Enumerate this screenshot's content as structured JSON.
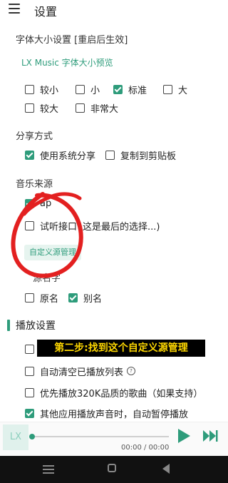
{
  "header": {
    "title": "设置"
  },
  "font_size": {
    "label": "字体大小设置 [重启后生效]",
    "preview": "LX Music 字体大小预览",
    "options": [
      {
        "label": "较小",
        "checked": false
      },
      {
        "label": "小",
        "checked": false
      },
      {
        "label": "标准",
        "checked": true
      },
      {
        "label": "大",
        "checked": false
      },
      {
        "label": "较大",
        "checked": false
      },
      {
        "label": "非常大",
        "checked": false
      }
    ]
  },
  "share": {
    "label": "分享方式",
    "options": [
      {
        "label": "使用系统分享",
        "checked": true
      },
      {
        "label": "复制到剪贴板",
        "checked": false
      }
    ]
  },
  "music_source": {
    "label": "音乐来源",
    "option1_text": "ap",
    "option2_text": "试听接口",
    "option2_note": "这是最后的选择...)",
    "custom_button": "自定义源管理"
  },
  "source_name": {
    "label_partial": "源名字",
    "options": [
      {
        "label": "原名",
        "checked": false
      },
      {
        "label": "别名",
        "checked": true
      }
    ]
  },
  "playback": {
    "title": "播放设置",
    "items": [
      {
        "label": "",
        "checked": false
      },
      {
        "label": "自动清空已播放列表",
        "checked": false
      },
      {
        "label": "优先播放320K品质的歌曲（如果支持）",
        "checked": false
      },
      {
        "label": "其他应用播放声音时，自动暂停播放",
        "checked": true
      }
    ]
  },
  "overlay_caption": "第二步:找到这个自定义源管理",
  "player": {
    "logo": "LX",
    "time": "00:00 / 00:00",
    "progress": 0.0
  },
  "colors": {
    "accent": "#2e9c7b",
    "scribble": "#e32020"
  }
}
